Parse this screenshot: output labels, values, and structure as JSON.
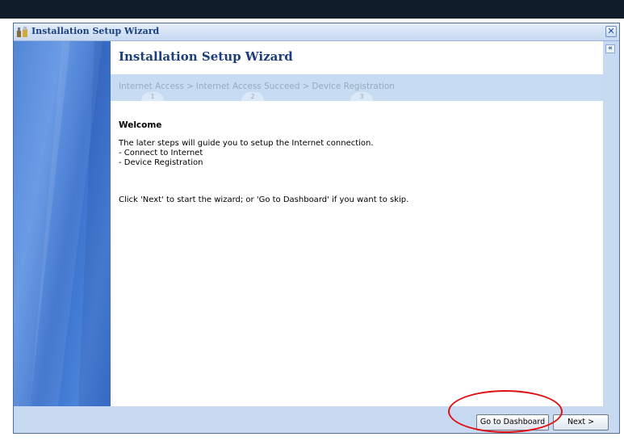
{
  "window": {
    "title": "Installation Setup Wizard",
    "close_icon": "close-icon",
    "collapse_icon": "double-chevron-left-icon"
  },
  "wizard": {
    "title": "Installation Setup Wizard",
    "steps": [
      {
        "label": "Internet Access",
        "number": "1"
      },
      {
        "label": "Internet Access Succeed",
        "number": "2"
      },
      {
        "label": "Device Registration",
        "number": "3"
      }
    ],
    "separator": ">"
  },
  "welcome": {
    "heading": "Welcome",
    "intro": "The later steps will guide you to setup the Internet connection.",
    "bullets": [
      "- Connect to Internet",
      "- Device Registration"
    ],
    "instruction": "Click 'Next' to start the wizard; or 'Go to Dashboard' if you want to skip."
  },
  "footer": {
    "go_to_dashboard_label": "Go to Dashboard",
    "next_label": "Next >"
  },
  "colors": {
    "highlight": "#e01010",
    "title_text": "#1c3f7c",
    "steps_bar": "#c7dcf3"
  }
}
